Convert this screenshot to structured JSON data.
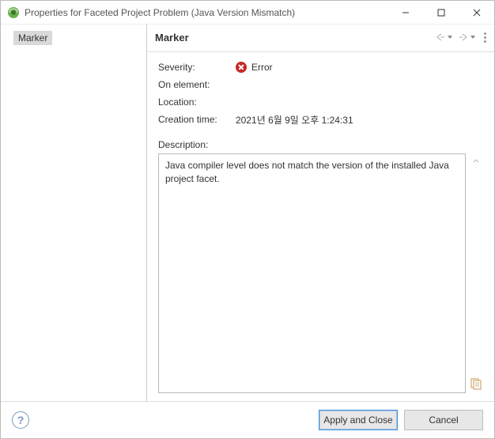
{
  "titlebar": {
    "title": "Properties for Faceted Project Problem (Java Version Mismatch)"
  },
  "sidebar": {
    "items": [
      {
        "label": "Marker",
        "selected": true
      }
    ]
  },
  "content": {
    "title": "Marker",
    "properties": {
      "severity_label": "Severity:",
      "severity_value": "Error",
      "on_element_label": "On element:",
      "on_element_value": "",
      "location_label": "Location:",
      "location_value": "",
      "creation_time_label": "Creation time:",
      "creation_time_value": "2021년 6월 9일 오후 1:24:31"
    },
    "description_label": "Description:",
    "description_value": "Java compiler level does not match the version of the installed Java project facet."
  },
  "buttons": {
    "apply_close": "Apply and Close",
    "cancel": "Cancel"
  }
}
